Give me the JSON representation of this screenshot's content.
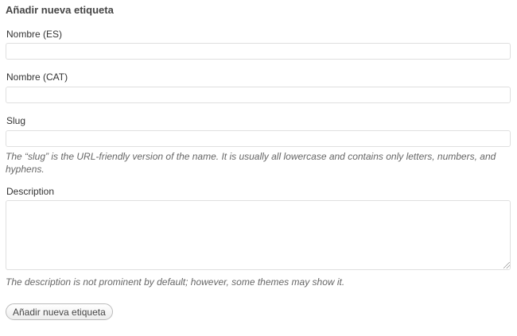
{
  "form": {
    "title": "Añadir nueva etiqueta",
    "fields": {
      "name_es": {
        "label": "Nombre (ES)",
        "value": ""
      },
      "name_cat": {
        "label": "Nombre (CAT)",
        "value": ""
      },
      "slug": {
        "label": "Slug",
        "value": "",
        "hint": "The “slug” is the URL-friendly version of the name. It is usually all lowercase and contains only letters, numbers, and hyphens."
      },
      "description": {
        "label": "Description",
        "value": "",
        "hint": "The description is not prominent by default; however, some themes may show it."
      }
    },
    "submit_label": "Añadir nueva etiqueta"
  }
}
